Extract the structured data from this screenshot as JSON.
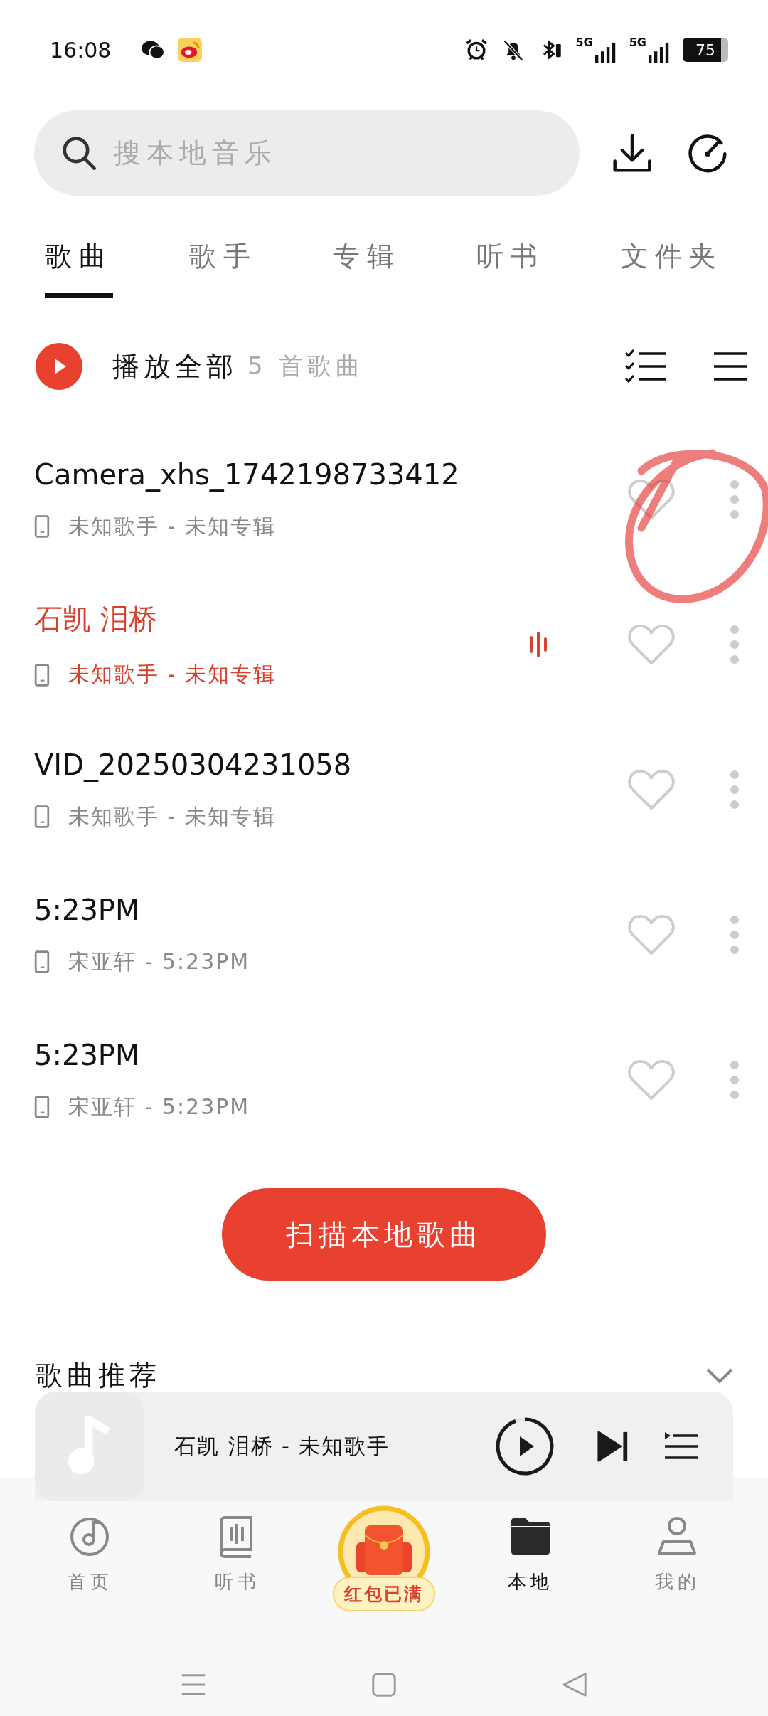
{
  "status_bar": {
    "time": "16:08",
    "networks": [
      "5G",
      "5G"
    ],
    "battery": "75"
  },
  "search": {
    "placeholder": "搜本地音乐"
  },
  "tabs": [
    {
      "label": "歌曲",
      "selected": true
    },
    {
      "label": "歌手",
      "selected": false
    },
    {
      "label": "专辑",
      "selected": false
    },
    {
      "label": "听书",
      "selected": false
    },
    {
      "label": "文件夹",
      "selected": false
    }
  ],
  "play_all": {
    "label": "播放全部",
    "count": "5 首歌曲"
  },
  "songs": [
    {
      "title": "Camera_xhs_1742198733412",
      "subtitle": "未知歌手 - 未知专辑",
      "playing": false
    },
    {
      "title": "石凯 泪桥",
      "subtitle": "未知歌手 - 未知专辑",
      "playing": true
    },
    {
      "title": "VID_20250304231058",
      "subtitle": "未知歌手 - 未知专辑",
      "playing": false
    },
    {
      "title": "5:23PM",
      "subtitle": "宋亚轩 - 5:23PM",
      "playing": false
    },
    {
      "title": "5:23PM",
      "subtitle": "宋亚轩 - 5:23PM",
      "playing": false
    }
  ],
  "scan_button": "扫描本地歌曲",
  "recommend": {
    "title": "歌曲推荐"
  },
  "mini_player": {
    "text": "石凯 泪桥 - 未知歌手"
  },
  "nav": [
    {
      "kind": "home",
      "label": "首页",
      "selected": false
    },
    {
      "kind": "books",
      "label": "听书",
      "selected": false
    },
    {
      "kind": "promo",
      "label": "红包已满"
    },
    {
      "kind": "local",
      "label": "本地",
      "selected": true
    },
    {
      "kind": "me",
      "label": "我的",
      "selected": false
    }
  ]
}
